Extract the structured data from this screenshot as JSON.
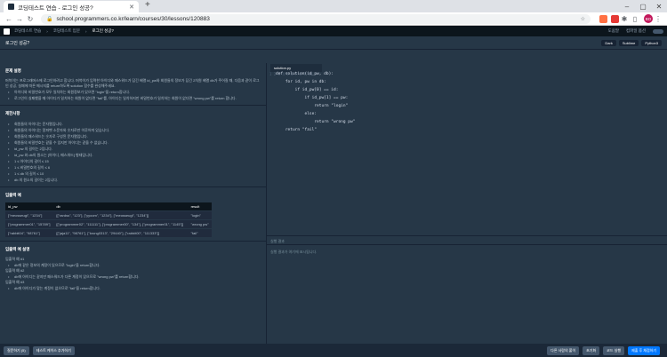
{
  "browser": {
    "tab_title": "코딩테스트 연습 - 로그인 성공?",
    "url": "school.programmers.co.kr/learn/courses/30/lessons/120883",
    "avatar": "BO"
  },
  "appbar": {
    "breadcrumbs": [
      "코딩테스트 연습",
      "코딩테스트 입문",
      "로그인 성공?"
    ],
    "right_items": [
      "도움말",
      "컴파일 옵션"
    ]
  },
  "titlebar": {
    "title": "로그인 성공?",
    "langs": [
      "Dark",
      "Sublime",
      "Python3"
    ]
  },
  "problem": {
    "section_desc_title": "문제 설명",
    "desc": "머쓱이는 프로그래머스에 로그인하려고 합니다. 머쓱이가 입력한 아이디와 패스워드가 담긴 배열 id_pw와 회원들의 정보가 담긴 2차원 배열 db가 주어질 때, 다음과 같이 로그인 성공, 실패에 따른 메시지를 return하도록 solution 함수를 완성해주세요.",
    "desc_bullets": [
      "아이디와 비밀번호가 모두 일치하는 회원정보가 있으면 \"login\"을 return합니다.",
      "로그인이 실패했을 때 아이디가 일치하는 회원이 없다면 \"fail\"를, 아이디는 일치하지만 비밀번호가 일치하는 회원이 없다면 \"wrong pw\"를 return 합니다."
    ],
    "section_constraints_title": "제한사항",
    "constraints": [
      "회원들의 아이디는 문자열입니다.",
      "회원들의 아이디는 알파벳 소문자와 숫자로만 이루어져 있습니다.",
      "회원들의 패스워드는 숫자로 구성된 문자열입니다.",
      "회원들의 비밀번호는 같을 수 있지만 아이디는 같을 수 없습니다.",
      "id_pw 의 길이는 2입니다.",
      "id_pw 와 db의 원소는 [아이디, 패스워드] 형태입니다.",
      "1 ≤ 아이디의 길이 ≤ 15",
      "1 ≤ 비밀번호의 길이 ≤ 6",
      "1 ≤ db 의 길이 ≤ 10",
      "db 의 원소의 길이는 2입니다."
    ],
    "section_io_title": "입출력 예",
    "io_headers": [
      "id_pw",
      "db",
      "result"
    ],
    "io_rows": [
      [
        "[\"meosseugi\", \"1234\"]",
        "[[\"rardss\", \"123\"], [\"yyoom\", \"1234\"], [\"meosseugi\", \"1234\"]]",
        "\"login\""
      ],
      [
        "[\"programmer01\", \"15789\"]",
        "[[\"programmer02\", \"111111\"], [\"programmer00\", \"134\"], [\"programmer01\", \"1145\"]]",
        "\"wrong pw\""
      ],
      [
        "[\"rabbit04\", \"98761\"]",
        "[[\"jaja11\", \"98761\"], [\"krong0313\", \"29440\"], [\"rabbit00\", \"111333\"]]",
        "\"fail\""
      ]
    ],
    "section_io_desc_title": "입출력 예 설명",
    "io_desc": [
      {
        "title": "입출력 예 #1",
        "text": "db에 같은 정보의 계정이 있으므로 \"login\"을 return합니다."
      },
      {
        "title": "입출력 예 #2",
        "text": "db에 아이디는 같지만 패스워드가 다른 계정이 있으므로 \"wrong pw\"를 return합니다."
      },
      {
        "title": "입출력 예 #3",
        "text": "db에 아이디가 맞는 계정이 없으므로 \"fail\"을 return합니다."
      }
    ]
  },
  "editor": {
    "filename": "solution.py",
    "line_numbers": "1\n2\n3\n4\n5\n6\n7\n8\n9\n10",
    "code_lines": [
      "def solution(id_pw, db):",
      "    for id, pw in db:",
      "        if id_pw[0] == id:",
      "            if id_pw[1] == pw:",
      "                return \"login\"",
      "            else:",
      "                return \"wrong pw\"",
      "    return \"fail\""
    ],
    "result_label": "실행 결과",
    "output_placeholder": "실행 결과가 여기에 표시됩니다."
  },
  "bottom": {
    "left_buttons": [
      "질문하기 (5)",
      "테스트 케이스 추가하기"
    ],
    "right_buttons": [
      "다른 사람의 풀이",
      "초기화",
      "코드 실행",
      "제출 후 채점하기"
    ]
  }
}
